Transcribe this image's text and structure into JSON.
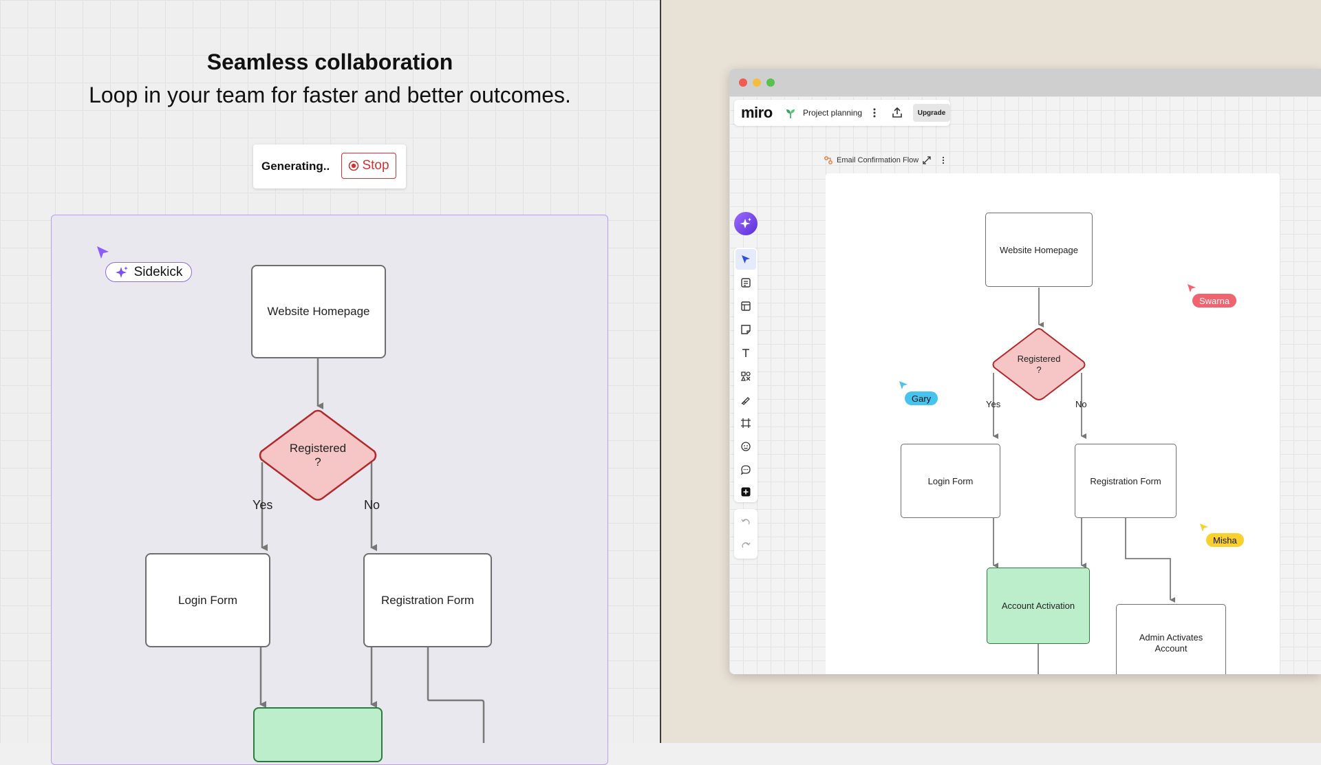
{
  "left": {
    "title": "Seamless collaboration",
    "subtitle": "Loop in your team for faster and better outcomes.",
    "generating_label": "Generating..",
    "stop_label": "Stop",
    "sidekick_label": "Sidekick",
    "flow": {
      "website_homepage": "Website Homepage",
      "registered_line1": "Registered",
      "registered_line2": "?",
      "yes": "Yes",
      "no": "No",
      "login_form": "Login Form",
      "registration_form": "Registration Form"
    }
  },
  "app": {
    "logo": "miro",
    "board_name": "Project planning",
    "upgrade_label": "Upgrade",
    "frame_name": "Email Confirmation Flow",
    "flow": {
      "website_homepage": "Website Homepage",
      "registered_line1": "Registered",
      "registered_line2": "?",
      "yes": "Yes",
      "no": "No",
      "login_form": "Login Form",
      "registration_form": "Registration Form",
      "account_activation": "Account Activation",
      "admin_activates_line1": "Admin Activates",
      "admin_activates_line2": "Account"
    },
    "collaborators": [
      {
        "name": "Swarna",
        "color": "#f0636f"
      },
      {
        "name": "Gary",
        "color": "#47c3f0"
      },
      {
        "name": "Misha",
        "color": "#f8d12f"
      }
    ],
    "toolbar_icons": [
      "select-icon",
      "templates-icon",
      "table-icon",
      "sticky-note-icon",
      "text-icon",
      "shapes-icon",
      "pen-icon",
      "frame-icon",
      "sticker-icon",
      "comment-icon",
      "more-apps-icon"
    ]
  },
  "colors": {
    "accent_purple": "#7b4fe8",
    "stop_red": "#c93434",
    "diamond_fill": "#f6c6c6",
    "diamond_stroke": "#b3292b",
    "activation_green": "#bdeecb"
  }
}
